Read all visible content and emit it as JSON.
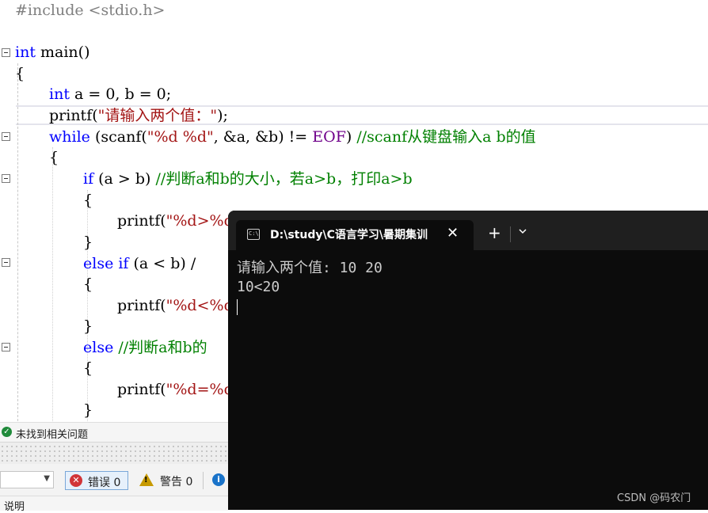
{
  "editor": {
    "lines": {
      "l1_pp": "#include <stdio.h>",
      "l2_kw": "int",
      "l2_rest": " main()",
      "l3": "{",
      "l4_kw": "int",
      "l4_rest": " a = 0, b = 0;",
      "l5_pre": "printf(",
      "l5_str": "\"请输入两个值：\"",
      "l5_post": ");",
      "l6_kw": "while",
      "l6_a": " (scanf(",
      "l6_str": "\"%d %d\"",
      "l6_b": ", &a, &b) != ",
      "l6_eof": "EOF",
      "l6_c": ") ",
      "l6_cmt": "//scanf从键盘输入a b的值",
      "l7": "{",
      "l8_kw": "if",
      "l8_rest": " (a > b) ",
      "l8_cmt": "//判断a和b的大小，若a>b，打印a>b",
      "l9": "{",
      "l10_pre": "printf(",
      "l10_str": "\"%d>%d",
      "l11": "}",
      "l12_kw": "else if",
      "l12_rest": " (a < b) /",
      "l13": "{",
      "l14_pre": "printf(",
      "l14_str": "\"%d<%d",
      "l15": "}",
      "l16_kw": "else",
      "l16_cmt": " //判断a和b的",
      "l17": "{",
      "l18_pre": "printf(",
      "l18_str": "\"%d=%d",
      "l19": "}"
    }
  },
  "status": {
    "no_issues": "未找到相关问题"
  },
  "error_list": {
    "errors_label": "错误 0",
    "warnings_label": "警告 0",
    "description_header": "说明"
  },
  "terminal": {
    "tab_title": "D:\\study\\C语言学习\\暑期集训",
    "close": "✕",
    "new_tab": "+",
    "output_line1": "请输入两个值: 10 20",
    "output_line2": "10<20"
  },
  "watermark": "CSDN @码农门",
  "colors": {
    "keyword": "#0000ff",
    "string": "#a31515",
    "comment": "#008000",
    "terminal_bg": "#0c0c0c"
  },
  "icons": {
    "fold": "minus-box-icon",
    "ok": "check-circle-icon",
    "error": "x-circle-icon",
    "warning": "warning-triangle-icon",
    "info": "info-circle-icon",
    "terminal": "cmd-icon"
  }
}
